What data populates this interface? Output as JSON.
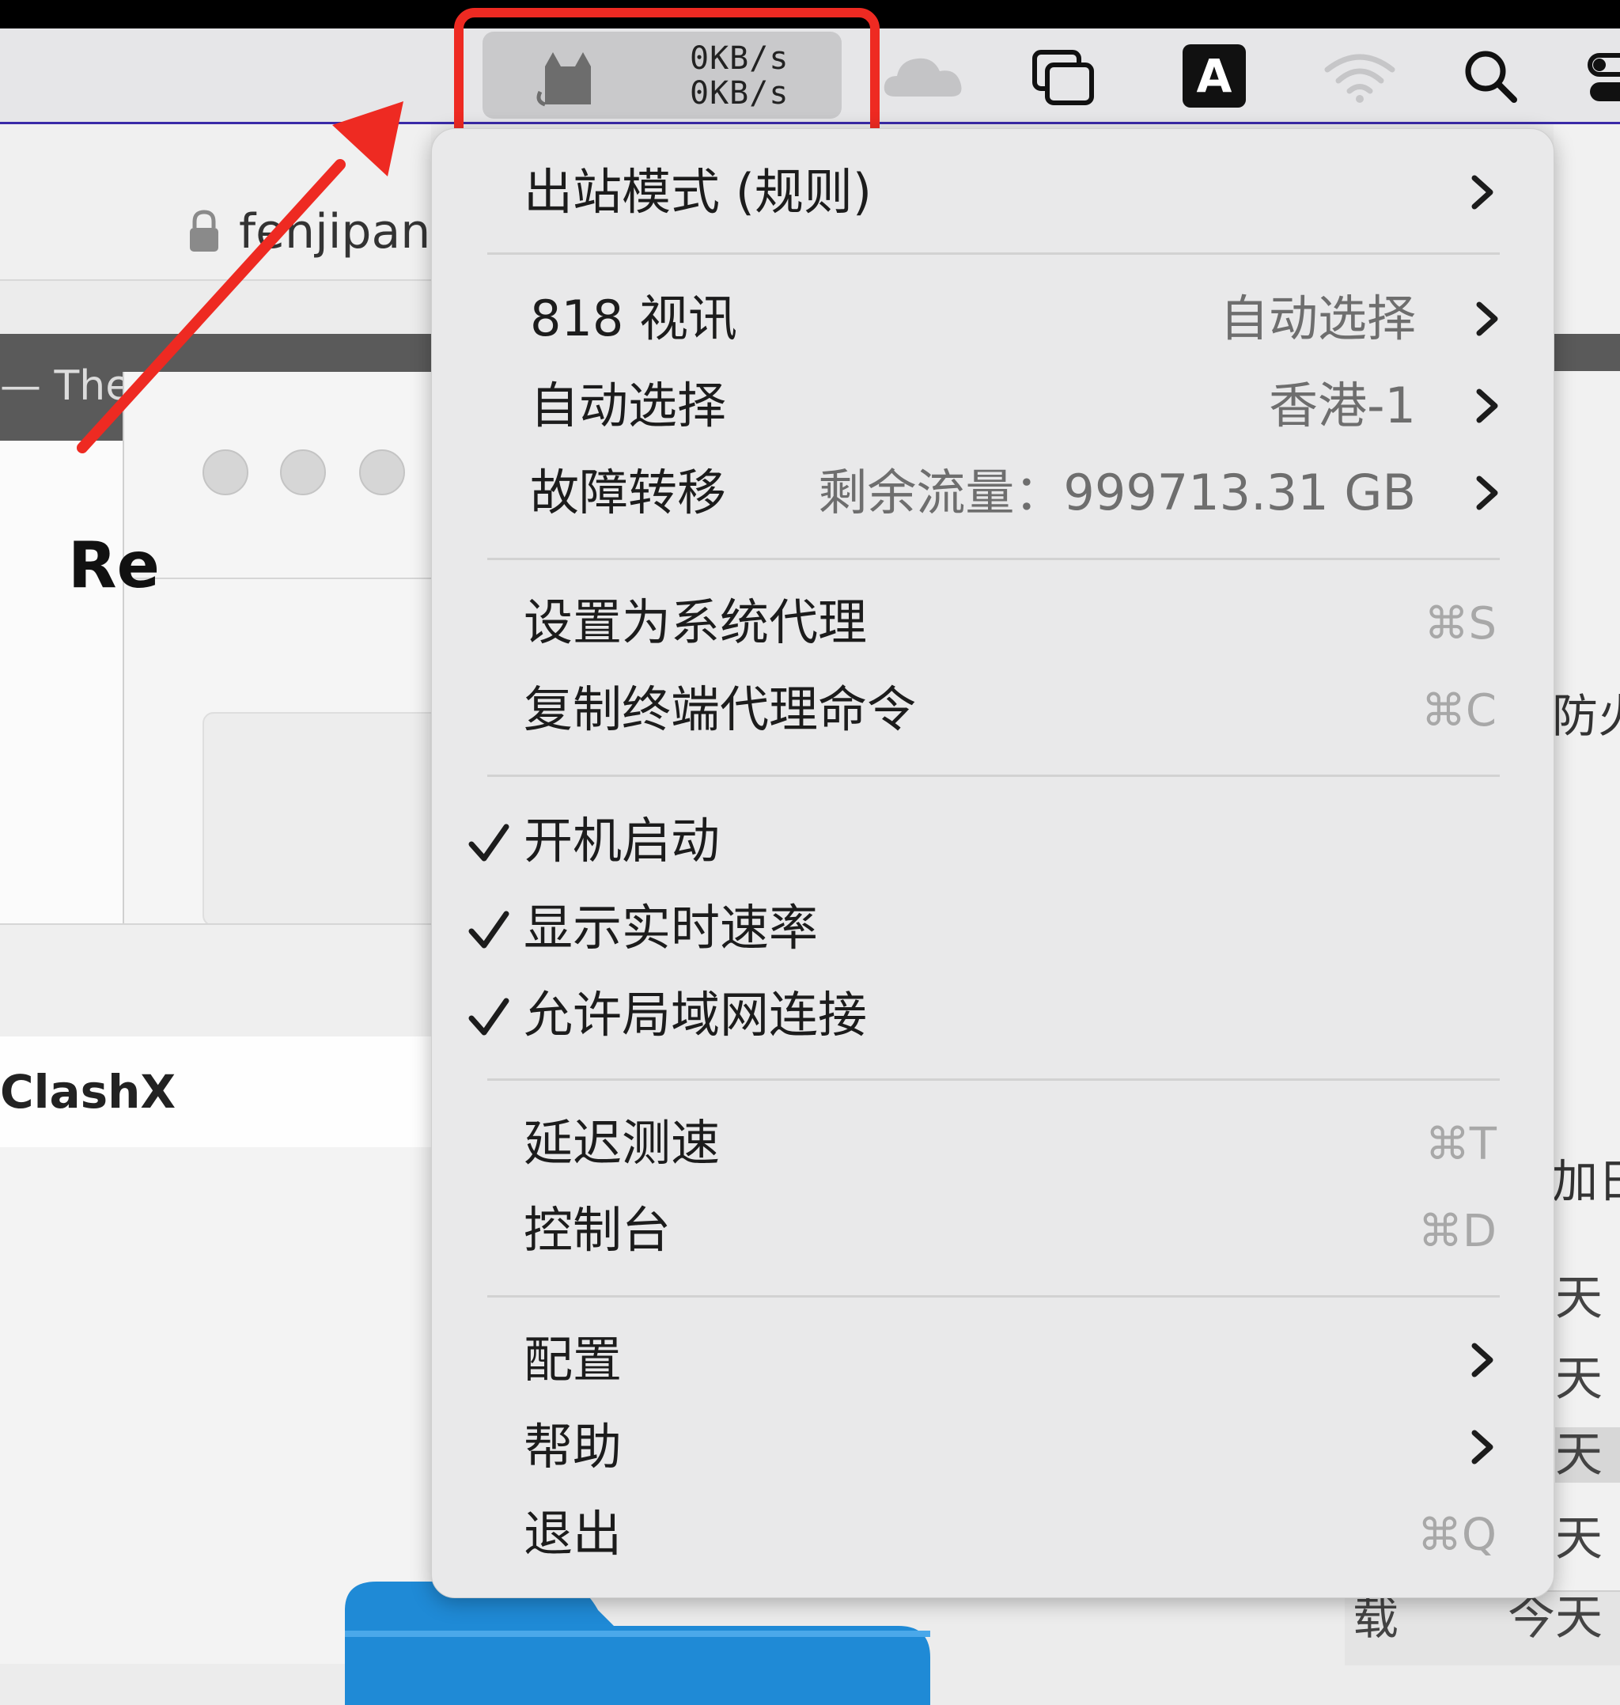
{
  "menubar": {
    "speed_up": "0KB/s",
    "speed_down": "0KB/s",
    "input_source_letter": "A",
    "icons": [
      "clashx-cat-icon",
      "cloud-icon",
      "windows-icon",
      "input-source-icon",
      "wifi-icon",
      "search-icon",
      "control-center-icon"
    ]
  },
  "background": {
    "address_text": "fenjipan.",
    "tab_text": "— The f",
    "partial_heading": "Re",
    "app_name": "ClashX",
    "right_fragments": {
      "fire": "防火",
      "add": "加日",
      "days": [
        "天",
        "天",
        "天",
        "天"
      ],
      "bottom_left": "载",
      "bottom_right": "今天"
    }
  },
  "menu": {
    "outbound_mode": "出站模式 (规则)",
    "proxy_groups": [
      {
        "label": "818 视讯",
        "value": "自动选择"
      },
      {
        "label": "自动选择",
        "value": "香港-1"
      },
      {
        "label": "故障转移",
        "value": "剩余流量：999713.31 GB"
      }
    ],
    "actions": [
      {
        "label": "设置为系统代理",
        "shortcut": "⌘S"
      },
      {
        "label": "复制终端代理命令",
        "shortcut": "⌘C"
      }
    ],
    "toggles": [
      {
        "label": "开机启动",
        "checked": true
      },
      {
        "label": "显示实时速率",
        "checked": true
      },
      {
        "label": "允许局域网连接",
        "checked": true
      }
    ],
    "tools": [
      {
        "label": "延迟测速",
        "shortcut": "⌘T"
      },
      {
        "label": "控制台",
        "shortcut": "⌘D"
      }
    ],
    "config": "配置",
    "help": "帮助",
    "quit": {
      "label": "退出",
      "shortcut": "⌘Q"
    }
  },
  "colors": {
    "highlight": "#ee2a22",
    "menu_bg": "#e9e9ea",
    "menubar_bg": "#e6e6e8",
    "accent_line": "#3a2aa8"
  }
}
